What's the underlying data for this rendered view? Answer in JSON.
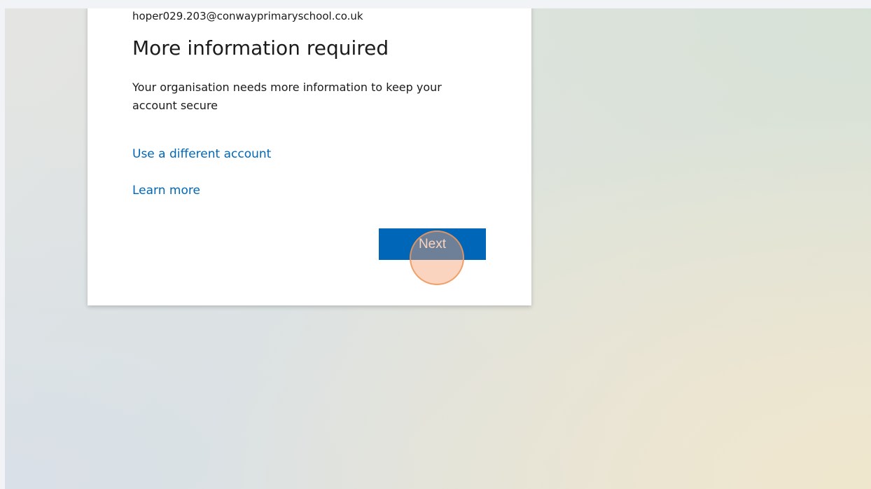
{
  "account": {
    "email": "hoper029.203@conwayprimaryschool.co.uk"
  },
  "content": {
    "title": "More information required",
    "description": "Your organisation needs more information to keep your account secure"
  },
  "links": {
    "different_account": "Use a different account",
    "learn_more": "Learn more"
  },
  "actions": {
    "next_label": "Next"
  },
  "colors": {
    "accent": "#0067b8",
    "click_marker": "#f5a06e"
  }
}
